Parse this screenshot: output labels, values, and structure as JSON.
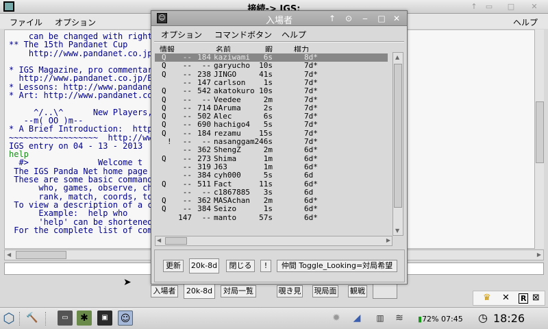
{
  "main_window": {
    "title": "接続-> IGS:",
    "menu": {
      "file": "ファイル",
      "options": "オプション",
      "help": "ヘルプ"
    },
    "console_lines": [
      "    can be changed with right c",
      "** The 15th Pandanet Cup",
      "    http://www.pandanet.co.jp/e",
      "",
      "* IGS Magazine, pro commentary",
      "  http://www.pandanet.co.jp/En",
      "* Lessons: http://www.pandanet",
      "* Art: http://www.pandanet.co.",
      "",
      "     ^/..\\^      New Players, t",
      "   --m( OO )m--",
      "* A Brief Introduction:  http:",
      "~~~~~~~~~~~~~~~~~~  http://www",
      "IGS entry on 04 - 13 - 2013",
      "help",
      "  #>              Welcome t",
      " The IGS Panda Net home page i",
      " These are some basic commands",
      "      who, games, observe, cha",
      "      rank, match, coords, tog",
      " To view a description of a co",
      "      Example:  help who",
      "      'help' can be shortened",
      " For the complete list of comm"
    ],
    "bottom_buttons": {
      "users": "入場者",
      "rank": "20k-8d",
      "games": "対局一覧",
      "observe": "覗き見",
      "present": "現局面",
      "watch": "観戦"
    }
  },
  "dialog": {
    "title": "入場者",
    "menu": {
      "options": "オプション",
      "command_button": "コマンドボタン",
      "help": "ヘルプ"
    },
    "columns": {
      "info": "情報",
      "name": "名前",
      "idle": "暇",
      "rank": "棋力"
    },
    "rows": [
      {
        "flag": "Q",
        "obs": "--",
        "play": "184",
        "name": "kaziwami",
        "idle": "6s",
        "rank": "8d*",
        "selected": true
      },
      {
        "flag": "Q",
        "obs": "--",
        "play": "--",
        "name": "garyucho",
        "idle": "10s",
        "rank": "7d*"
      },
      {
        "flag": "Q",
        "obs": "--",
        "play": "238",
        "name": "JINGO",
        "idle": "41s",
        "rank": "7d*"
      },
      {
        "flag": "",
        "obs": "--",
        "play": "147",
        "name": "carlson",
        "idle": "1s",
        "rank": "7d*"
      },
      {
        "flag": "Q",
        "obs": "--",
        "play": "542",
        "name": "akatokuro",
        "idle": "10s",
        "rank": "7d*"
      },
      {
        "flag": "Q",
        "obs": "--",
        "play": "--",
        "name": "Veedee",
        "idle": "2m",
        "rank": "7d*"
      },
      {
        "flag": "Q",
        "obs": "--",
        "play": "714",
        "name": "DAruma",
        "idle": "2s",
        "rank": "7d*"
      },
      {
        "flag": "Q",
        "obs": "--",
        "play": "502",
        "name": "Alec",
        "idle": "6s",
        "rank": "7d*"
      },
      {
        "flag": "Q",
        "obs": "--",
        "play": "690",
        "name": "hachigo4",
        "idle": "5s",
        "rank": "7d*"
      },
      {
        "flag": "Q",
        "obs": "--",
        "play": "184",
        "name": "rezamu",
        "idle": "15s",
        "rank": "7d*"
      },
      {
        "flag": "!",
        "obs": "--",
        "play": "--",
        "name": "nasanggam2",
        "idle": "46s",
        "rank": "7d*"
      },
      {
        "flag": "",
        "obs": "--",
        "play": "362",
        "name": "ShengZ",
        "idle": "2m",
        "rank": "6d*"
      },
      {
        "flag": "Q",
        "obs": "--",
        "play": "273",
        "name": "Shima",
        "idle": "1m",
        "rank": "6d*"
      },
      {
        "flag": "",
        "obs": "--",
        "play": "319",
        "name": "J63",
        "idle": "1m",
        "rank": "6d*"
      },
      {
        "flag": "",
        "obs": "--",
        "play": "384",
        "name": "cyh000",
        "idle": "5s",
        "rank": "6d"
      },
      {
        "flag": "Q",
        "obs": "--",
        "play": "511",
        "name": "Fact",
        "idle": "11s",
        "rank": "6d*"
      },
      {
        "flag": "",
        "obs": "--",
        "play": "--",
        "name": "c1867885",
        "idle": "3s",
        "rank": "6d"
      },
      {
        "flag": "Q",
        "obs": "--",
        "play": "362",
        "name": "MASAchan",
        "idle": "2m",
        "rank": "6d*"
      },
      {
        "flag": "Q",
        "obs": "--",
        "play": "384",
        "name": "Seizo",
        "idle": "1s",
        "rank": "6d*"
      },
      {
        "flag": "",
        "obs": "147",
        "play": "--",
        "name": "manto",
        "idle": "57s",
        "rank": "6d*"
      }
    ],
    "buttons": {
      "refresh": "更新",
      "rank_range": "20k-8d",
      "close": "閉じる",
      "bang": "!",
      "toggle": "仲間 Toggle_Looking=対局希望"
    }
  },
  "taskbar": {
    "battery": "72% 07:45",
    "clock": "18:26"
  },
  "icons": [
    "app-window-icon",
    "minimize-icon",
    "maximize-icon",
    "close-icon",
    "pin-icon",
    "search-icon",
    "hammer-icon",
    "terminal-icon",
    "panda-icon",
    "monitor-icon",
    "avatar-icon",
    "brightness-icon",
    "wifi-signal-icon",
    "network-icon",
    "battery-icon",
    "clock-icon",
    "crown-icon",
    "r-icon"
  ]
}
